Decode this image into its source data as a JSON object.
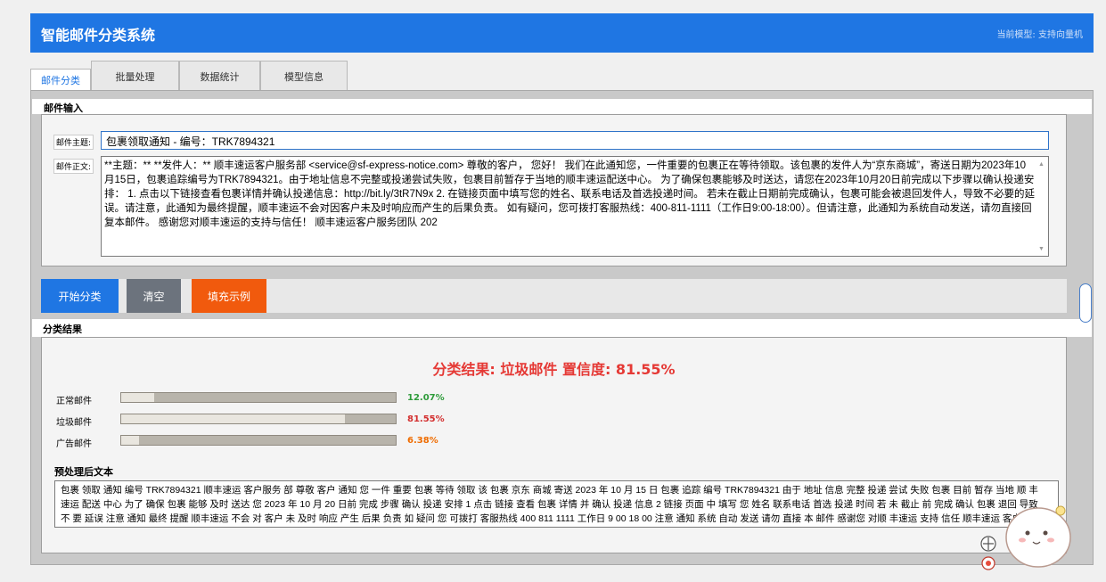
{
  "header": {
    "title": "智能邮件分类系统",
    "model_info": "当前模型: 支持向量机"
  },
  "tabs": [
    {
      "label": "邮件分类",
      "active": true
    },
    {
      "label": "批量处理",
      "active": false
    },
    {
      "label": "数据统计",
      "active": false
    },
    {
      "label": "模型信息",
      "active": false
    }
  ],
  "input_section": {
    "title": "邮件输入",
    "subject_label": "邮件主题:",
    "subject_value": "包裹领取通知 - 编号：TRK7894321",
    "body_label": "邮件正文:",
    "body_value": "**主题：** **发件人：** 顺丰速运客户服务部 <service@sf-express-notice.com> 尊敬的客户， 您好！ 我们在此通知您，一件重要的包裹正在等待领取。该包裹的发件人为“京东商城”，寄送日期为2023年10月15日，包裹追踪编号为TRK7894321。由于地址信息不完整或投递尝试失败，包裹目前暂存于当地的顺丰速运配送中心。 为了确保包裹能够及时送达，请您在2023年10月20日前完成以下步骤以确认投递安排： 1. 点击以下链接查看包裹详情并确认投递信息：http://bit.ly/3tR7N9x 2. 在链接页面中填写您的姓名、联系电话及首选投递时间。 若未在截止日期前完成确认，包裹可能会被退回发件人，导致不必要的延误。请注意，此通知为最终提醒，顺丰速运不会对因客户未及时响应而产生的后果负责。 如有疑问，您可拨打客服热线：400-811-1111（工作日9:00-18:00）。但请注意，此通知为系统自动发送，请勿直接回复本邮件。 感谢您对顺丰速运的支持与信任！ 顺丰速运客户服务团队 202"
  },
  "buttons": {
    "classify": "开始分类",
    "clear": "清空",
    "fill_example": "填充示例"
  },
  "result_section": {
    "title": "分类结果",
    "headline": "分类结果: 垃圾邮件    置信度: 81.55%",
    "probabilities": [
      {
        "label": "正常邮件",
        "value": 0.1207,
        "text": "12.07%",
        "color": "#2e9b3a"
      },
      {
        "label": "垃圾邮件",
        "value": 0.8155,
        "text": "81.55%",
        "color": "#d32f2f"
      },
      {
        "label": "广告邮件",
        "value": 0.0638,
        "text": "6.38%",
        "color": "#ef6c00"
      }
    ],
    "preprocessed_title": "预处理后文本",
    "preprocessed_text": "包裹 领取 通知 编号 TRK7894321 顺丰速运 客户服务 部 尊敬 客户 通知 您 一件 重要 包裹 等待 领取 该 包裹 京东 商城 寄送 2023 年 10 月 15 日 包裹 追踪 编号 TRK7894321 由于 地址 信息 完整 投递 尝试 失败 包裹 目前 暂存 当地 顺 丰速运 配送 中心 为了 确保 包裹 能够 及时 送达 您 2023 年 10 月 20 日前 完成 步骤 确认 投递 安排 1 点击 链接 查看 包裹 详情 并 确认 投递 信息 2 链接 页面 中 填写 您 姓名 联系电话 首选 投递 时间 若 未 截止 前 完成 确认 包裹 退回 导致 不 要 延误 注意 通知 最终 提醒 顺丰速运 不会 对 客户 未 及时 响应 产生 后果 负责 如 疑问 您 可拨打 客服热线 400 811 1111 工作日 9 00 18 00 注意 通知 系统 自动 发送 请勿 直接 本 邮件 感谢您 对顺 丰速运 支持 信任 顺丰速运 客户服 务团队 202"
  },
  "colors": {
    "header_bg": "#1f76e3",
    "primary_button": "#1f76e3",
    "secondary_button": "#6c737d",
    "accent_button": "#f15a0d",
    "headline": "#e53935"
  }
}
